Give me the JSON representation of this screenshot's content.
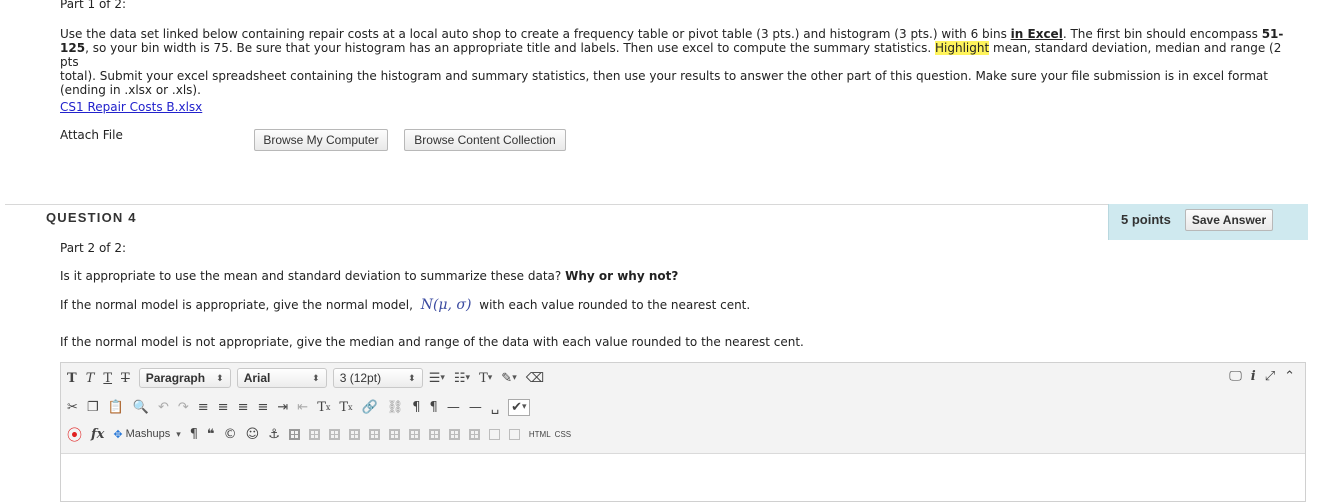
{
  "q3": {
    "part": "Part 1 of 2:",
    "instructions": [
      "Use the data set linked below containing repair costs at a local auto shop to create a frequency table or pivot table (3 pts.) and histogram (3 pts.) with 6 bins in Excel.  The first bin should encompass 51-",
      "125, so your bin width is 75.  Be sure that your histogram has an appropriate title and labels.  Then use excel to compute the summary statistics.  Highlight mean, standard deviation, median and range (2 pts",
      "total).  Submit your excel spreadsheet containing the histogram and summary statistics, then use your results to answer the other part of this question.  Make sure your file submission is in excel format",
      "(ending in .xlsx or .xls)."
    ],
    "file_link": "CS1 Repair Costs B.xlsx",
    "attach_label": "Attach File",
    "browse_computer": "Browse My Computer",
    "browse_content": "Browse Content Collection"
  },
  "q4": {
    "heading": "QUESTION 4",
    "points": "5 points",
    "save": "Save Answer",
    "part": "Part 2 of 2:",
    "question_a": "Is it appropriate to use the mean and standard deviation to summarize these data?",
    "question_b": "Why or why not?",
    "normal_a": "If the normal model is appropriate, give the normal model,",
    "normal_model": "N(μ, σ)",
    "normal_b": "with each value rounded to the nearest cent.",
    "not_normal": "If the normal model is not appropriate, give the median and range of the data with each value rounded to the nearest cent."
  },
  "editor": {
    "paragraph": "Paragraph",
    "font": "Arial",
    "size": "3 (12pt)",
    "mashups": "Mashups",
    "html": "HTML",
    "css": "CSS"
  }
}
